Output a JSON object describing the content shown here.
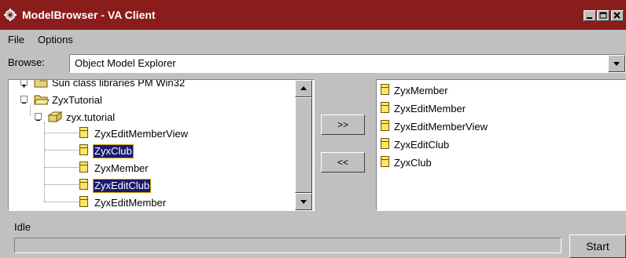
{
  "window": {
    "title": "ModelBrowser - VA Client"
  },
  "menu": [
    {
      "label": "File"
    },
    {
      "label": "Options"
    }
  ],
  "browse": {
    "label": "Browse:",
    "value": "Object Model Explorer"
  },
  "tree": {
    "partial_top": "Sun class libraries PM Win32",
    "project": "ZyxTutorial",
    "package": "zyx.tutorial",
    "classes": [
      "ZyxEditMemberView",
      "ZyxClub",
      "ZyxMember",
      "ZyxEditClub",
      "ZyxEditMember"
    ],
    "selected": [
      "ZyxClub",
      "ZyxEditClub"
    ]
  },
  "buttons": {
    "add": ">>",
    "remove": "<<",
    "start": "Start"
  },
  "selected_list": [
    "ZyxMember",
    "ZyxEditMember",
    "ZyxEditMemberView",
    "ZyxEditClub",
    "ZyxClub"
  ],
  "status": {
    "text": "Idle",
    "progress": 0
  },
  "colors": {
    "titlebar": "#8b1c1c",
    "selection": "#1a1a6e",
    "class_icon": "#ffe46a"
  }
}
